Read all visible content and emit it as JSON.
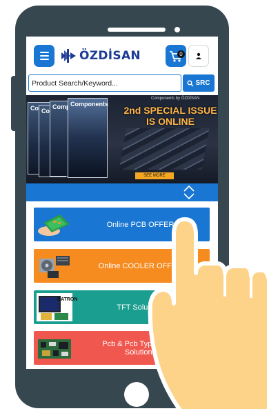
{
  "header": {
    "logo_text": "ÖZDİSAN",
    "cart_count": "0"
  },
  "search": {
    "placeholder": "Product Search/Keyword...",
    "button_label": "SRC"
  },
  "banner": {
    "kicker": "Components by ÖZDİSAN",
    "title": "2nd SPECIAL ISSUE\nIS ONLINE",
    "magazine_word": "Components",
    "magazine_prefix": "Co",
    "cta_label": "SEE MORE"
  },
  "offers": [
    {
      "label": "Online PCB OFFER",
      "color": "#1976d2"
    },
    {
      "label": "Online COOLER OFFER",
      "color": "#f68b1f"
    },
    {
      "label": "TFT Solutions",
      "color": "#1a9e8f",
      "brand": "BATRON"
    },
    {
      "label": "Pcb & Pcb Typesetting\nSolutions",
      "color": "#f0584f"
    }
  ],
  "colors": {
    "phone_body": "#37474f",
    "accent": "#1976d2",
    "skin": "#fdd38a"
  }
}
